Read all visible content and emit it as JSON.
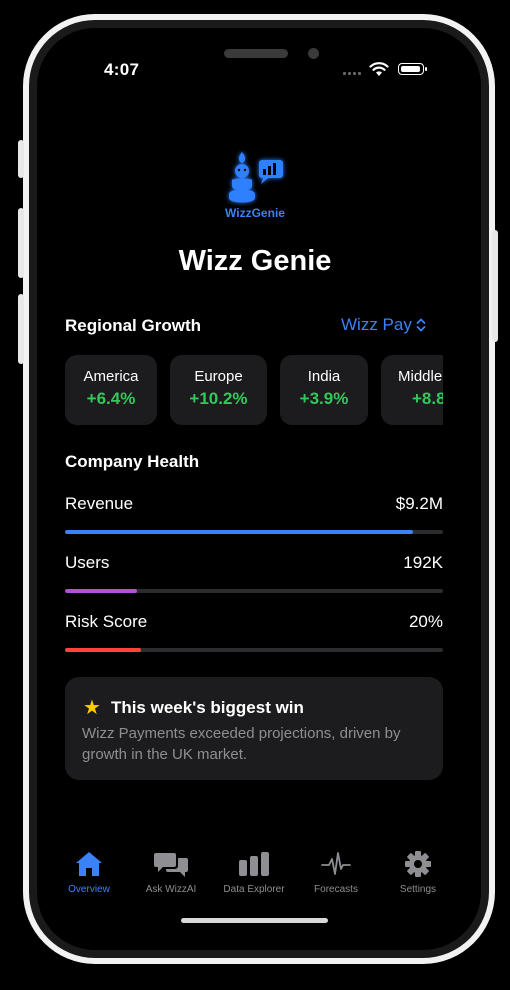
{
  "status_bar": {
    "time": "4:07"
  },
  "app": {
    "logo_text": "WizzGenie",
    "title": "Wizz Genie"
  },
  "regional_growth": {
    "title": "Regional Growth",
    "selector": "Wizz Pay",
    "cards": [
      {
        "region": "America",
        "growth": "+6.4%"
      },
      {
        "region": "Europe",
        "growth": "+10.2%"
      },
      {
        "region": "India",
        "growth": "+3.9%"
      },
      {
        "region": "Middle",
        "growth": "+8.8"
      }
    ]
  },
  "company_health": {
    "title": "Company Health",
    "metrics": [
      {
        "label": "Revenue",
        "value": "$9.2M",
        "progress": 0.92,
        "color": "#3b82f6"
      },
      {
        "label": "Users",
        "value": "192K",
        "progress": 0.19,
        "color": "#af52de"
      },
      {
        "label": "Risk Score",
        "value": "20%",
        "progress": 0.2,
        "color": "#ff453a"
      }
    ]
  },
  "win": {
    "title": "This week's biggest win",
    "text": "Wizz Payments exceeded projections, driven by growth in the UK market.",
    "icon": "star-icon"
  },
  "tab_bar": {
    "tabs": [
      {
        "label": "Overview",
        "icon": "home-icon",
        "active": true
      },
      {
        "label": "Ask WizzAI",
        "icon": "chat-bubbles-icon",
        "active": false
      },
      {
        "label": "Data Explorer",
        "icon": "bar-chart-icon",
        "active": false
      },
      {
        "label": "Forecasts",
        "icon": "waveform-icon",
        "active": false
      },
      {
        "label": "Settings",
        "icon": "gear-icon",
        "active": false
      }
    ]
  },
  "colors": {
    "accent": "#3b82f6",
    "positive": "#34c759",
    "background": "#000000",
    "card": "#1c1c1e"
  }
}
